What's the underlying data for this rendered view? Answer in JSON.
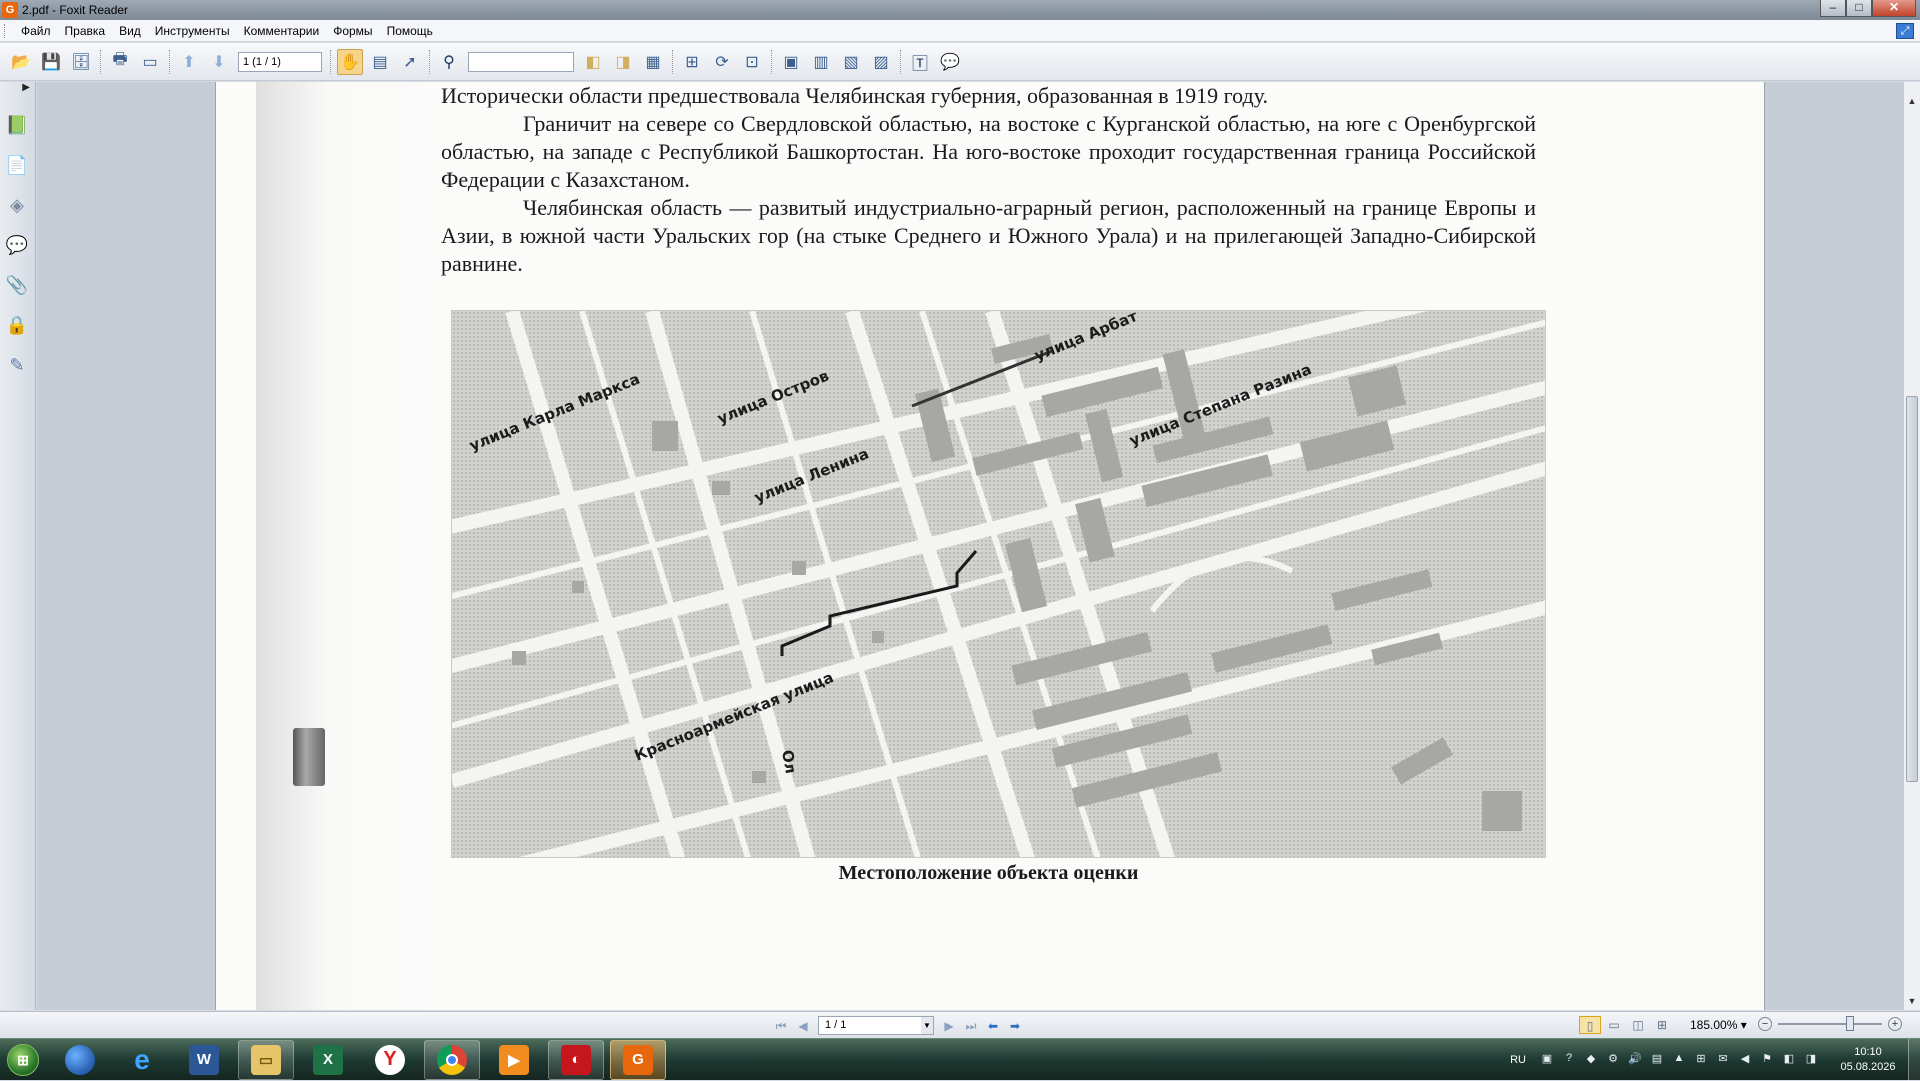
{
  "window": {
    "title": "2.pdf - Foxit Reader",
    "app_icon": "G",
    "btn_min": "–",
    "btn_max": "□",
    "btn_close": "✕"
  },
  "menu": {
    "items": [
      "Файл",
      "Правка",
      "Вид",
      "Инструменты",
      "Комментарии",
      "Формы",
      "Помощь"
    ]
  },
  "toolbar": {
    "page_value": "1 (1 / 1)",
    "search_value": ""
  },
  "document": {
    "para1": "Исторически области предшествовала Челябинская губерния, образованная в 1919 году.",
    "para2": "Граничит на севере со Свердловской областью, на востоке с Курганской областью, на юге с Оренбургской областью, на западе с Республикой Башкортостан. На юго-востоке проходит государственная граница Российской Федерации с Казахстаном.",
    "para3": "Челябинская область — развитый индустриально-аграрный регион, расположенный на границе Европы и Азии, в южной части Уральских гор (на стыке Среднего и Южного Урала) и на прилегающей Западно-Сибирской равнине.",
    "caption": "Местоположение объекта оценки"
  },
  "map": {
    "street_labels": [
      "улица Карла Маркса",
      "улица Остров",
      "улица Ленина",
      "улица Арбат",
      "улица Степана Разина",
      "Красноармейская улица",
      "Ол"
    ]
  },
  "status": {
    "page_value": "1 / 1",
    "zoom": "185.00%"
  },
  "taskbar": {
    "apps": [
      "start",
      "browser-blue",
      "internet-explorer",
      "word",
      "file-explorer",
      "excel",
      "yandex",
      "chrome",
      "media-player",
      "red-app",
      "foxit-reader"
    ]
  },
  "tray": {
    "lang": "RU",
    "time": "10:10",
    "date": "05.08.2026"
  },
  "colors": {
    "accent": "#3a7bd5",
    "foxit": "#e8670c",
    "taskbar": "#1e3a33"
  }
}
